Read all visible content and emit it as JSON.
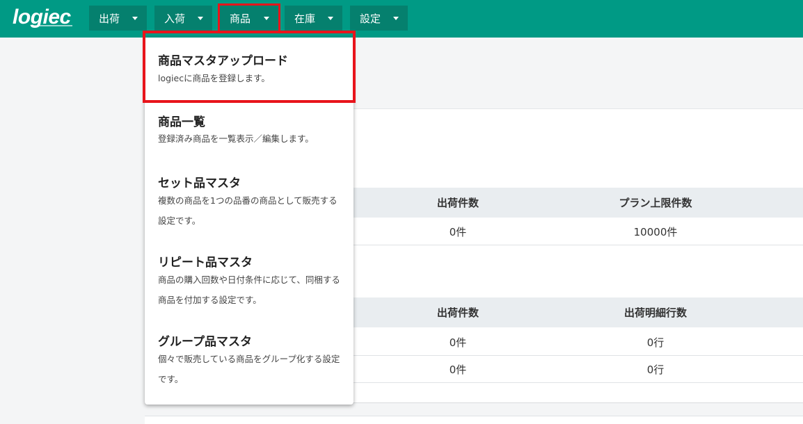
{
  "brand": {
    "logo_text": "logiec"
  },
  "navbar": {
    "items": [
      {
        "label": "出荷"
      },
      {
        "label": "入荷"
      },
      {
        "label": "商品"
      },
      {
        "label": "在庫"
      },
      {
        "label": "設定"
      }
    ],
    "active_index": 2
  },
  "dropdown": {
    "items": [
      {
        "title": "商品マスタアップロード",
        "desc": "logiecに商品を登録します。",
        "highlighted": true
      },
      {
        "title": "商品一覧",
        "desc": "登録済み商品を一覧表示／編集します。"
      },
      {
        "title": "セット品マスタ",
        "desc": "複数の商品を1つの品番の商品として販売する設定です。"
      },
      {
        "title": "リピート品マスタ",
        "desc": "商品の購入回数や日付条件に応じて、同梱する商品を付加する設定です。"
      },
      {
        "title": "グループ品マスタ",
        "desc": "個々で販売している商品をグループ化する設定です。"
      }
    ]
  },
  "table1": {
    "headers": [
      "出荷件数",
      "プラン上限件数"
    ],
    "rows": [
      [
        "0件",
        "10000件"
      ]
    ]
  },
  "table2": {
    "headers": [
      "出荷件数",
      "出荷明細行数"
    ],
    "rows": [
      [
        "0件",
        "0行"
      ],
      [
        "0件",
        "0行"
      ]
    ]
  },
  "colors": {
    "navbar": "#009a85",
    "nav_button": "#05806e",
    "highlight": "#e8141b"
  }
}
